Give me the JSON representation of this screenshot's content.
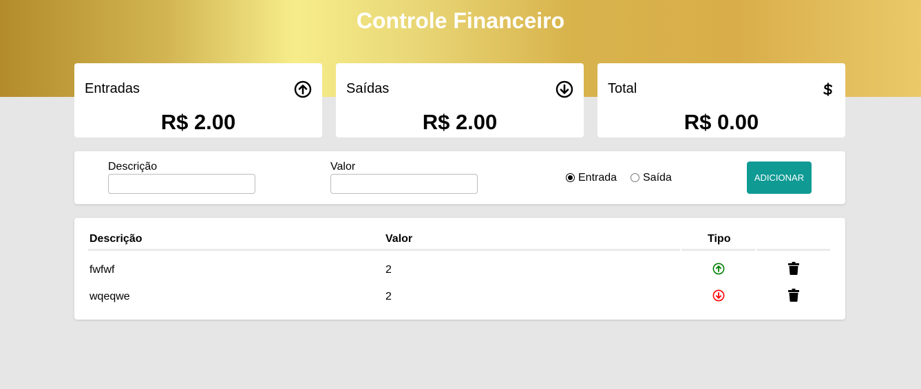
{
  "header": {
    "title": "Controle Financeiro"
  },
  "cards": {
    "income": {
      "label": "Entradas",
      "amount": "R$ 2.00",
      "icon": "arrow-circle-up-icon"
    },
    "expense": {
      "label": "Saídas",
      "amount": "R$ 2.00",
      "icon": "arrow-circle-down-icon"
    },
    "total": {
      "label": "Total",
      "amount": "R$ 0.00",
      "icon": "dollar-icon"
    }
  },
  "form": {
    "description_label": "Descrição",
    "description_value": "",
    "value_label": "Valor",
    "value_value": "",
    "radio_income_label": "Entrada",
    "radio_expense_label": "Saída",
    "selected_type": "Entrada",
    "add_button_label": "ADICIONAR"
  },
  "table": {
    "headers": {
      "description": "Descrição",
      "value": "Valor",
      "type": "Tipo"
    },
    "rows": [
      {
        "description": "fwfwf",
        "value": "2",
        "type": "entrada",
        "type_icon": "arrow-circle-up-icon",
        "type_color": "#008000"
      },
      {
        "description": "wqeqwe",
        "value": "2",
        "type": "saida",
        "type_icon": "arrow-circle-down-icon",
        "type_color": "#ff0000"
      }
    ]
  },
  "colors": {
    "accent_button": "#0f9a94",
    "header_gradient_gold": "#d8b34c",
    "background": "#e6e6e6"
  }
}
